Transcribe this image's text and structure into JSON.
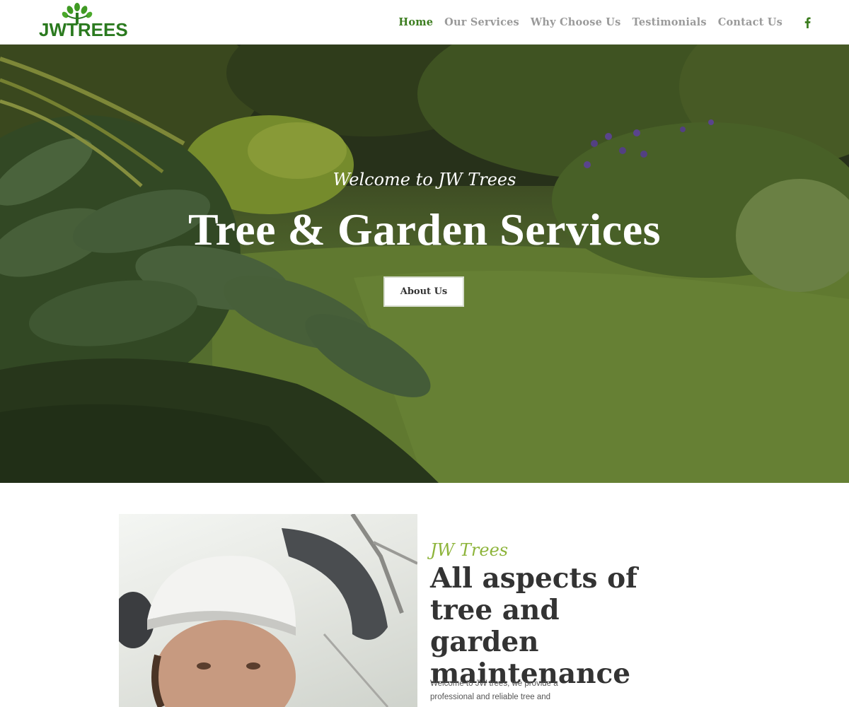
{
  "brand": {
    "logo_text": "JWTREES",
    "color": "#2b7a1f"
  },
  "nav": {
    "items": [
      {
        "label": "Home",
        "active": true
      },
      {
        "label": "Our Services",
        "active": false
      },
      {
        "label": "Why Choose Us",
        "active": false
      },
      {
        "label": "Testimonials",
        "active": false
      },
      {
        "label": "Contact Us",
        "active": false
      }
    ],
    "social_icon": "facebook-icon",
    "active_color": "#3c7d1f",
    "inactive_color": "#9a9a9a"
  },
  "hero": {
    "subtitle": "Welcome to JW Trees",
    "title": "Tree & Garden Services",
    "button_label": "About Us"
  },
  "about": {
    "tag": "JW Trees",
    "heading": "All aspects of tree and garden maintenance",
    "text": "Welcome to JW trees, we provide a professional and reliable tree and",
    "tag_color": "#8db43a"
  }
}
